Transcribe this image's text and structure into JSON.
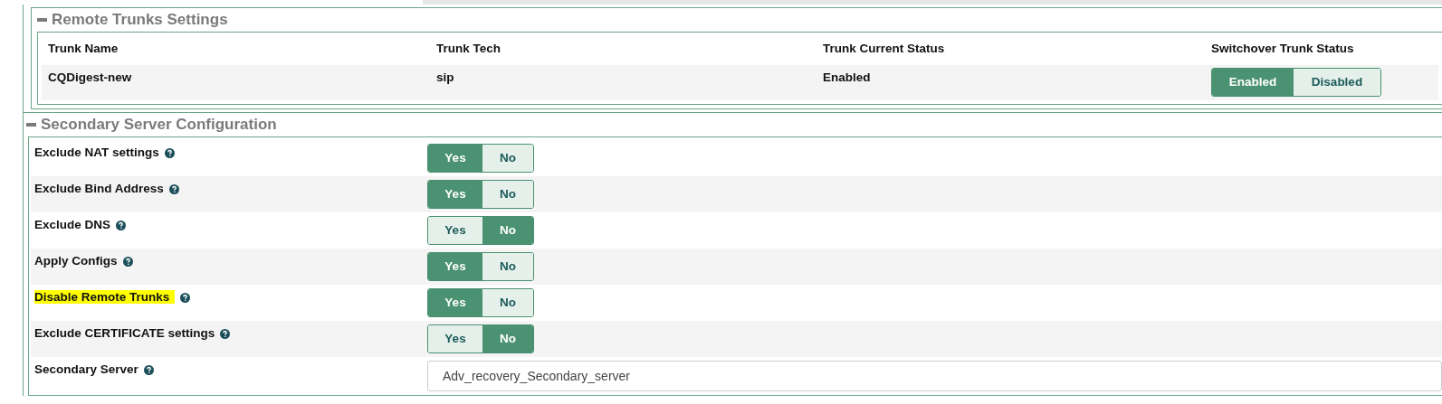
{
  "remote_trunks": {
    "legend": "Remote Trunks Settings",
    "columns": [
      "Trunk Name",
      "Trunk Tech",
      "Trunk Current Status",
      "Switchover Trunk Status"
    ],
    "rows": [
      {
        "name": "CQDigest-new",
        "tech": "sip",
        "status": "Enabled",
        "switchover": [
          {
            "label": "Enabled",
            "selected": true
          },
          {
            "label": "Disabled",
            "selected": false
          }
        ]
      }
    ]
  },
  "secondary": {
    "legend": "Secondary Server Configuration",
    "settings": [
      {
        "kind": "toggle",
        "label": "Exclude NAT settings",
        "highlighted": false,
        "options": [
          {
            "label": "Yes",
            "selected": true
          },
          {
            "label": "No",
            "selected": false
          }
        ]
      },
      {
        "kind": "toggle",
        "label": "Exclude Bind Address",
        "highlighted": false,
        "options": [
          {
            "label": "Yes",
            "selected": true
          },
          {
            "label": "No",
            "selected": false
          }
        ]
      },
      {
        "kind": "toggle",
        "label": "Exclude DNS",
        "highlighted": false,
        "options": [
          {
            "label": "Yes",
            "selected": false
          },
          {
            "label": "No",
            "selected": true
          }
        ]
      },
      {
        "kind": "toggle",
        "label": "Apply Configs",
        "highlighted": false,
        "options": [
          {
            "label": "Yes",
            "selected": true
          },
          {
            "label": "No",
            "selected": false
          }
        ]
      },
      {
        "kind": "toggle",
        "label": "Disable Remote Trunks",
        "highlighted": true,
        "options": [
          {
            "label": "Yes",
            "selected": true
          },
          {
            "label": "No",
            "selected": false
          }
        ]
      },
      {
        "kind": "toggle",
        "label": "Exclude CERTIFICATE settings",
        "highlighted": false,
        "options": [
          {
            "label": "Yes",
            "selected": false
          },
          {
            "label": "No",
            "selected": true
          }
        ]
      },
      {
        "kind": "text",
        "label": "Secondary Server",
        "highlighted": false,
        "value": "Adv_recovery_Secondary_server"
      }
    ]
  }
}
